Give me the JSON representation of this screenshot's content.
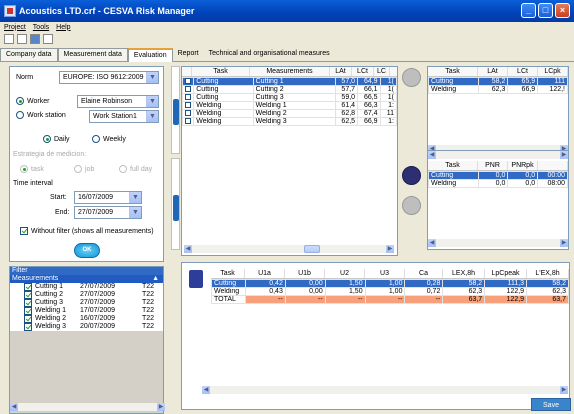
{
  "window": {
    "title": "Acoustics LTD.crf - CESVA Risk Manager"
  },
  "menu": [
    "Project",
    "Tools",
    "Help"
  ],
  "tabs": [
    "Company data",
    "Measurement data",
    "Evaluation",
    "Report",
    "Technical and organisational measures"
  ],
  "left": {
    "norm_label": "Norm",
    "norm_value": "EUROPE: ISO 9612:2009",
    "worker_label": "Worker",
    "worker_value": "Elaine Robinson",
    "station_label": "Work station",
    "station_value": "Work Station1",
    "daily": "Daily",
    "weekly": "Weekly",
    "strategy_label": "Estrategia de medicion:",
    "strat_task": "task",
    "strat_job": "job",
    "strat_full": "full day",
    "interval_label": "Time interval",
    "start_label": "Start:",
    "start_value": "16/07/2009",
    "end_label": "End:",
    "end_value": "27/07/2009",
    "nofilter": "Without filter (shows all measurements)",
    "ok": "OK"
  },
  "filter": {
    "title": "Filter",
    "header": "Measurements",
    "rows": [
      {
        "name": "Cutting 1",
        "date": "27/07/2009",
        "time": "T22"
      },
      {
        "name": "Cutting 2",
        "date": "27/07/2009",
        "time": "T22"
      },
      {
        "name": "Cutting 3",
        "date": "27/07/2009",
        "time": "T22"
      },
      {
        "name": "Welding 1",
        "date": "17/07/2009",
        "time": "T22"
      },
      {
        "name": "Welding 2",
        "date": "16/07/2009",
        "time": "T22"
      },
      {
        "name": "Welding 3",
        "date": "20/07/2009",
        "time": "T22"
      }
    ]
  },
  "meas": {
    "headers": [
      "Task",
      "Measurements",
      "LAt",
      "LCt",
      "LC"
    ],
    "rows": [
      [
        "Cutting",
        "Cutting 1",
        "57,0",
        "64,9",
        "1("
      ],
      [
        "Cutting",
        "Cutting 2",
        "57,7",
        "66,1",
        "1("
      ],
      [
        "Cutting",
        "Cutting 3",
        "59,0",
        "66,5",
        "1("
      ],
      [
        "Welding",
        "Welding 1",
        "61,4",
        "66,3",
        "1:"
      ],
      [
        "Welding",
        "Welding 2",
        "62,8",
        "67,4",
        "11"
      ],
      [
        "Welding",
        "Welding 3",
        "62,5",
        "66,9",
        "1:"
      ]
    ]
  },
  "tasksum": {
    "headers": [
      "Task",
      "LAt",
      "LCt",
      "LCpk"
    ],
    "rows": [
      [
        "Cutting",
        "58,2",
        "65,9",
        "111"
      ],
      [
        "Welding",
        "62,3",
        "66,9",
        "122,!"
      ]
    ]
  },
  "pnr": {
    "headers": [
      "Task",
      "PNR",
      "PNRpk",
      ""
    ],
    "rows": [
      [
        "Cutting",
        "0,0",
        "0,0",
        "00:00"
      ],
      [
        "Welding",
        "0,0",
        "0,0",
        "08:00"
      ]
    ]
  },
  "bottom": {
    "headers": [
      "Task",
      "U1a",
      "U1b",
      "U2",
      "U3",
      "Ca",
      "LEX,8h",
      "LpCpeak",
      "L'EX,8h"
    ],
    "rows": [
      [
        "Cutting",
        "0,42",
        "0,00",
        "1,50",
        "1,00",
        "0,28",
        "58,2",
        "111,3",
        "58,2"
      ],
      [
        "Welding",
        "0,43",
        "0,00",
        "1,50",
        "1,00",
        "0,72",
        "62,3",
        "122,9",
        "62,3"
      ],
      [
        "TOTAL",
        "--",
        "--",
        "--",
        "--",
        "--",
        "63,7",
        "122,9",
        "63,7"
      ]
    ]
  },
  "save": "Save",
  "colors": {
    "accent": "#316ac5",
    "total": "#f7a079",
    "titlebar": "#0a5fd8"
  }
}
